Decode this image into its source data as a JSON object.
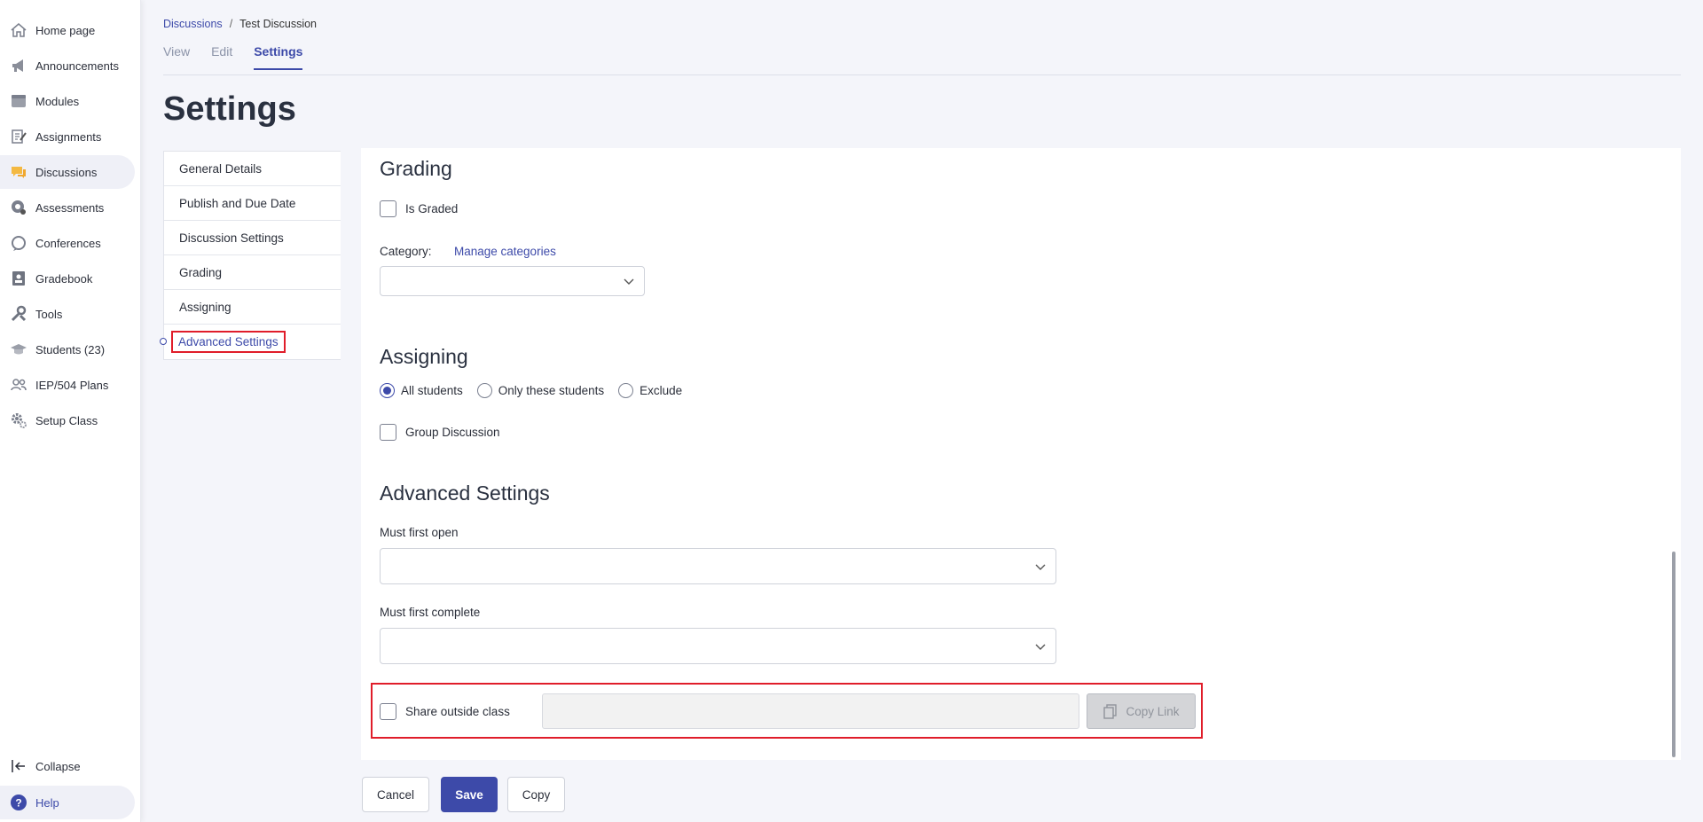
{
  "sidebar": {
    "items": [
      {
        "label": "Home page",
        "icon": "home-icon"
      },
      {
        "label": "Announcements",
        "icon": "megaphone-icon"
      },
      {
        "label": "Modules",
        "icon": "folder-icon"
      },
      {
        "label": "Assignments",
        "icon": "assignment-icon"
      },
      {
        "label": "Discussions",
        "icon": "chat-icon"
      },
      {
        "label": "Assessments",
        "icon": "assessment-icon"
      },
      {
        "label": "Conferences",
        "icon": "conference-icon"
      },
      {
        "label": "Gradebook",
        "icon": "gradebook-icon"
      },
      {
        "label": "Tools",
        "icon": "tools-icon"
      },
      {
        "label": "Students (23)",
        "icon": "graduation-cap-icon"
      },
      {
        "label": "IEP/504 Plans",
        "icon": "people-icon"
      },
      {
        "label": "Setup Class",
        "icon": "gear-icon"
      }
    ],
    "active_index": 4,
    "collapse_label": "Collapse",
    "help_label": "Help"
  },
  "breadcrumb": {
    "parent": "Discussions",
    "separator": "/",
    "current": "Test Discussion"
  },
  "tabs": [
    {
      "label": "View"
    },
    {
      "label": "Edit"
    },
    {
      "label": "Settings"
    }
  ],
  "active_tab": "Settings",
  "page_title": "Settings",
  "section_nav": [
    {
      "label": "General Details"
    },
    {
      "label": "Publish and Due Date"
    },
    {
      "label": "Discussion Settings"
    },
    {
      "label": "Grading"
    },
    {
      "label": "Assigning"
    },
    {
      "label": "Advanced Settings"
    }
  ],
  "grading": {
    "title": "Grading",
    "is_graded_label": "Is Graded",
    "is_graded": false,
    "category_label": "Category:",
    "manage_categories": "Manage categories",
    "category_value": ""
  },
  "assigning": {
    "title": "Assigning",
    "options": [
      "All students",
      "Only these students",
      "Exclude"
    ],
    "selected": "All students",
    "group_discussion_label": "Group Discussion",
    "group_discussion": false
  },
  "advanced": {
    "title": "Advanced Settings",
    "must_first_open_label": "Must first open",
    "must_first_open_value": "",
    "must_first_complete_label": "Must first complete",
    "must_first_complete_value": "",
    "share_outside_label": "Share outside class",
    "share_outside": false,
    "share_link_value": "",
    "copy_link_label": "Copy Link"
  },
  "footer": {
    "cancel": "Cancel",
    "save": "Save",
    "copy": "Copy"
  },
  "colors": {
    "accent": "#3d4aa9",
    "highlight": "#e01d2a",
    "discussions_icon": "#f4b942"
  }
}
